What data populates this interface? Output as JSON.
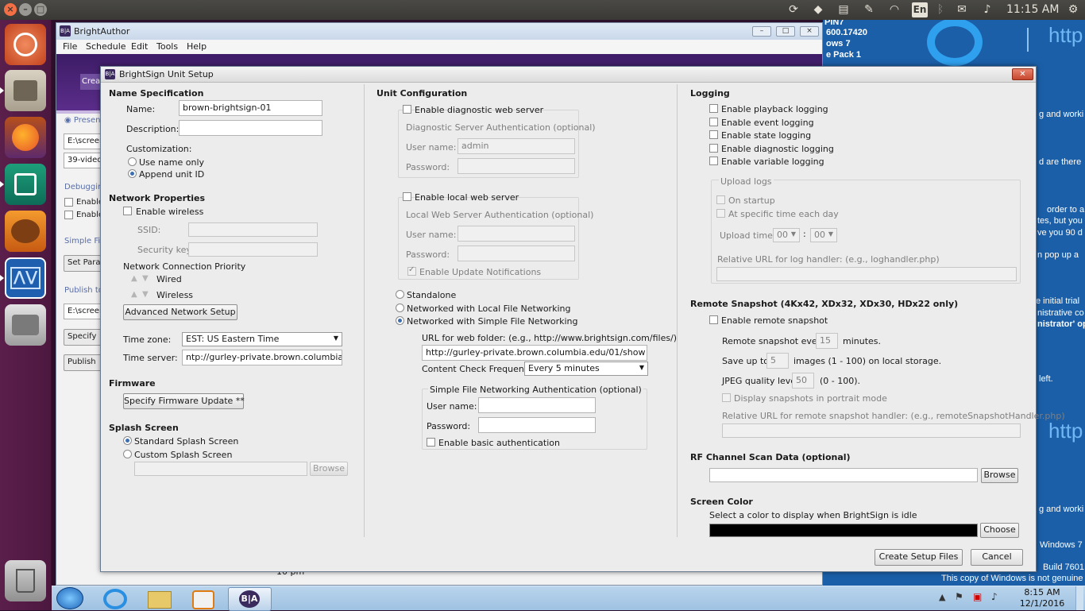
{
  "topbar": {
    "lang": "En",
    "clock": "11:15 AM",
    "tray_icons": [
      "dropbox-icon",
      "network-icon",
      "wifi-icon",
      "keyboard-icon",
      "bluetooth-icon",
      "mail-icon",
      "volume-icon"
    ]
  },
  "launcher": {
    "items": [
      "ubuntu-dash",
      "files",
      "firefox",
      "app-green",
      "app-fox",
      "brightsign-monitor",
      "disk"
    ],
    "trash": "trash"
  },
  "vm_bg": {
    "line1": "PIN7",
    "line2": "600.17420",
    "line3": "ows 7",
    "line4": "e Pack 1",
    "http1": "http",
    "text1": "g and worki",
    "text2": "d are there",
    "text3": "order to a",
    "text4": "tes, but you",
    "text5": "ve you 90 d",
    "text6": "n pop up a",
    "text7": "e initial trial",
    "text8": "nistrative co",
    "text9": "nistrator' op",
    "text10": "left.",
    "http2": "http",
    "text11": "g and worki",
    "win_label": "Windows 7",
    "build": "Build 7601",
    "genuine": "This copy of Windows is not genuine",
    "clock_time": "8:15 AM",
    "clock_date": "12/1/2016",
    "under_text": "10 pm"
  },
  "ba_main": {
    "title": "BrightAuthor",
    "menu": [
      "File",
      "Schedule",
      "Edit",
      "Tools",
      "Help"
    ],
    "tab_partial": "Crea",
    "present": "Presen",
    "path1": "E:\\screen",
    "video": "39-video",
    "debugging": "Debuggin",
    "enable1": "Enable",
    "enable2": "Enable",
    "simple": "Simple Fil",
    "set_params": "Set Para",
    "publish_to": "Publish to",
    "path2": "E:\\screen",
    "specify": "Specify",
    "publish": "Publish"
  },
  "dialog": {
    "title": "BrightSign Unit Setup",
    "name_spec": {
      "header": "Name Specification",
      "name_label": "Name:",
      "name_value": "brown-brightsign-01",
      "desc_label": "Description:",
      "desc_value": "",
      "custom_label": "Customization:",
      "opt_name_only": "Use name only",
      "opt_append": "Append unit ID"
    },
    "network": {
      "header": "Network Properties",
      "enable_wireless": "Enable wireless",
      "ssid_label": "SSID:",
      "security_label": "Security key:",
      "priority_label": "Network Connection Priority",
      "wired": "Wired",
      "wireless": "Wireless",
      "advanced_btn": "Advanced Network Setup",
      "tz_label": "Time zone:",
      "tz_value": "EST: US Eastern Time",
      "ts_label": "Time server:",
      "ts_value": "ntp://gurley-private.brown.columbia.edu"
    },
    "firmware": {
      "header": "Firmware",
      "btn": "Specify Firmware Update **"
    },
    "splash": {
      "header": "Splash Screen",
      "standard": "Standard Splash Screen",
      "custom": "Custom Splash Screen",
      "browse": "Browse"
    },
    "unit_config": {
      "header": "Unit Configuration",
      "diag_server": "Enable diagnostic web server",
      "diag_auth": "Diagnostic Server Authentication (optional)",
      "user_label": "User name:",
      "user_value": "admin",
      "pass_label": "Password:",
      "local_server": "Enable local web server",
      "local_auth": "Local Web Server Authentication (optional)",
      "user_label2": "User name:",
      "pass_label2": "Password:",
      "update_notif": "Enable Update Notifications",
      "standalone": "Standalone",
      "local_net": "Networked with Local File Networking",
      "simple_net": "Networked with Simple File Networking",
      "url_label": "URL for web folder: (e.g., http://www.brightsign.com/files/)",
      "url_value": "http://gurley-private.brown.columbia.edu/01/show",
      "freq_label": "Content Check Frequency:",
      "freq_value": "Every 5 minutes",
      "sfn_auth": "Simple File Networking Authentication (optional)",
      "user_label3": "User name:",
      "pass_label3": "Password:",
      "basic_auth": "Enable basic authentication"
    },
    "logging": {
      "header": "Logging",
      "playback": "Enable playback logging",
      "event": "Enable event logging",
      "state": "Enable state logging",
      "diagnostic": "Enable diagnostic logging",
      "variable": "Enable variable logging",
      "upload_logs": "Upload logs",
      "on_startup": "On startup",
      "specific_time": "At specific time each day",
      "upload_time": "Upload time:",
      "hh": "00",
      "mm": "00",
      "colon": ":",
      "relative_url": "Relative URL for log handler: (e.g., loghandler.php)"
    },
    "remote_snapshot": {
      "header": "Remote Snapshot (4Kx42, XDx32, XDx30, HDx22 only)",
      "enable": "Enable remote snapshot",
      "every_label": "Remote snapshot every",
      "every_value": "15",
      "minutes": "minutes.",
      "save_label": "Save up to",
      "save_value": "5",
      "images_label": "images (1 - 100) on local storage.",
      "jpeg_label": "JPEG quality level",
      "jpeg_value": "50",
      "jpeg_range": "(0 - 100).",
      "portrait": "Display snapshots in portrait mode",
      "relative_url": "Relative URL for remote snapshot handler: (e.g., remoteSnapshotHandler.php)"
    },
    "rf_scan": {
      "header": "RF Channel Scan Data (optional)",
      "browse": "Browse"
    },
    "screen_color": {
      "header": "Screen Color",
      "desc": "Select a color to display when BrightSign is idle",
      "color": "#000000",
      "choose": "Choose"
    },
    "footer": {
      "create": "Create Setup Files",
      "cancel": "Cancel"
    }
  }
}
